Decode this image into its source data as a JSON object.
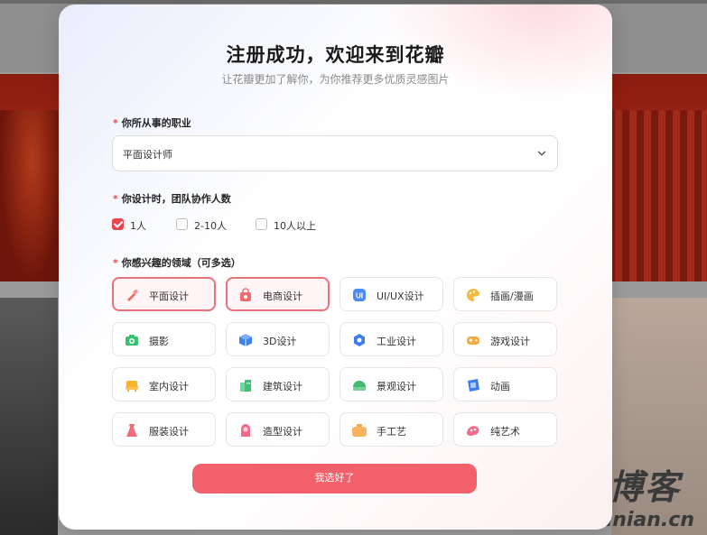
{
  "modal": {
    "title": "注册成功，欢迎来到花瓣",
    "subtitle": "让花瓣更加了解你，为你推荐更多优质灵感图片"
  },
  "profession": {
    "required_mark": "*",
    "label": "你所从事的职业",
    "selected": "平面设计师"
  },
  "team": {
    "required_mark": "*",
    "label": "你设计时，团队协作人数",
    "options": [
      {
        "label": "1人",
        "checked": true
      },
      {
        "label": "2-10人",
        "checked": false
      },
      {
        "label": "10人以上",
        "checked": false
      }
    ]
  },
  "interests": {
    "required_mark": "*",
    "label": "你感兴趣的领域（可多选）",
    "items": [
      {
        "label": "平面设计",
        "icon": "brush-icon",
        "selected": true,
        "color": "#f06c6c"
      },
      {
        "label": "电商设计",
        "icon": "shopping-bag-icon",
        "selected": true,
        "color": "#f06c6c"
      },
      {
        "label": "UI/UX设计",
        "icon": "ui-icon",
        "selected": false,
        "color": "#4a8cf7"
      },
      {
        "label": "插画/漫画",
        "icon": "palette-icon",
        "selected": false,
        "color": "#f5b942"
      },
      {
        "label": "摄影",
        "icon": "camera-icon",
        "selected": false,
        "color": "#36c26e"
      },
      {
        "label": "3D设计",
        "icon": "cube-icon",
        "selected": false,
        "color": "#3d82f0"
      },
      {
        "label": "工业设计",
        "icon": "gear-icon",
        "selected": false,
        "color": "#3a7cf0"
      },
      {
        "label": "游戏设计",
        "icon": "gamepad-icon",
        "selected": false,
        "color": "#f5a742"
      },
      {
        "label": "室内设计",
        "icon": "sofa-icon",
        "selected": false,
        "color": "#f5b330"
      },
      {
        "label": "建筑设计",
        "icon": "building-icon",
        "selected": false,
        "color": "#3dc173"
      },
      {
        "label": "景观设计",
        "icon": "landscape-icon",
        "selected": false,
        "color": "#3dbb6e"
      },
      {
        "label": "动画",
        "icon": "film-icon",
        "selected": false,
        "color": "#3a7cf0"
      },
      {
        "label": "服装设计",
        "icon": "dress-icon",
        "selected": false,
        "color": "#f06c7c"
      },
      {
        "label": "造型设计",
        "icon": "style-icon",
        "selected": false,
        "color": "#f06c8c"
      },
      {
        "label": "手工艺",
        "icon": "pottery-icon",
        "selected": false,
        "color": "#f5a742"
      },
      {
        "label": "纯艺术",
        "icon": "art-icon",
        "selected": false,
        "color": "#f06c8c"
      }
    ]
  },
  "submit_label": "我选好了",
  "watermark": {
    "title": "不念博客",
    "url": "www.bunian.cn"
  },
  "colors": {
    "accent": "#f2606c",
    "selected_border": "#e8727a",
    "required": "#e8454e"
  }
}
